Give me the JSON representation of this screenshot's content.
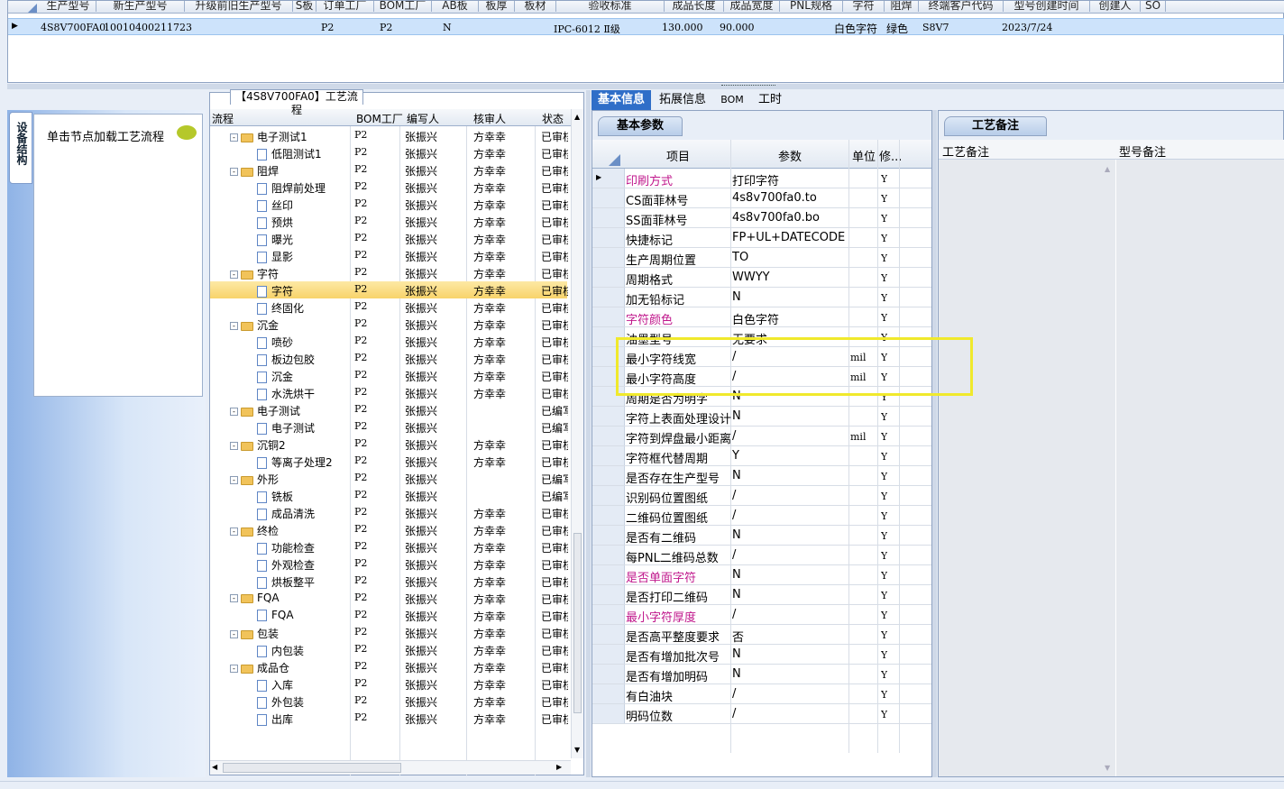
{
  "top_grid": {
    "columns": [
      "生产型号",
      "新生产型号",
      "升级前旧生产型号",
      "S板",
      "订单工厂",
      "BOM工厂",
      "AB板",
      "板厚",
      "板材",
      "验收标准",
      "成品长度",
      "成品宽度",
      "PNL规格",
      "字符",
      "阻焊",
      "终端客户代码",
      "型号创建时间",
      "创建人",
      "SO"
    ],
    "row": {
      "model": "4S8V700FA0",
      "new_model": "10010400211723",
      "order_factory": "P2",
      "bom_factory": "P2",
      "ab": "N",
      "standard": "IPC-6012 Ⅱ级",
      "length": "130.000",
      "width": "90.000",
      "character": "白色字符",
      "solder": "绿色",
      "customer_code": "S8V7",
      "created": "2023/7/24"
    }
  },
  "left_panel": {
    "vertical_tab": "设备结构",
    "load_text": "单击节点加载工艺流程"
  },
  "tree": {
    "title": "【4S8V700FA0】工艺流程",
    "headers": {
      "flow": "流程",
      "bom": "BOM工厂",
      "writer": "编写人",
      "checker": "核审人",
      "status": "状态"
    },
    "rows": [
      {
        "name": "电子测试1",
        "folder": true,
        "bom": "P2",
        "writer": "张振兴",
        "checker": "方幸幸",
        "status": "已审核"
      },
      {
        "name": "低阻测试1",
        "folder": false,
        "bom": "P2",
        "writer": "张振兴",
        "checker": "方幸幸",
        "status": "已审核"
      },
      {
        "name": "阻焊",
        "folder": true,
        "bom": "P2",
        "writer": "张振兴",
        "checker": "方幸幸",
        "status": "已审核"
      },
      {
        "name": "阻焊前处理",
        "folder": false,
        "bom": "P2",
        "writer": "张振兴",
        "checker": "方幸幸",
        "status": "已审核"
      },
      {
        "name": "丝印",
        "folder": false,
        "bom": "P2",
        "writer": "张振兴",
        "checker": "方幸幸",
        "status": "已审核"
      },
      {
        "name": "预烘",
        "folder": false,
        "bom": "P2",
        "writer": "张振兴",
        "checker": "方幸幸",
        "status": "已审核"
      },
      {
        "name": "曝光",
        "folder": false,
        "bom": "P2",
        "writer": "张振兴",
        "checker": "方幸幸",
        "status": "已审核"
      },
      {
        "name": "显影",
        "folder": false,
        "bom": "P2",
        "writer": "张振兴",
        "checker": "方幸幸",
        "status": "已审核"
      },
      {
        "name": "字符",
        "folder": true,
        "bom": "P2",
        "writer": "张振兴",
        "checker": "方幸幸",
        "status": "已审核"
      },
      {
        "name": "字符",
        "folder": false,
        "bom": "P2",
        "writer": "张振兴",
        "checker": "方幸幸",
        "status": "已审核",
        "selected": true
      },
      {
        "name": "终固化",
        "folder": false,
        "bom": "P2",
        "writer": "张振兴",
        "checker": "方幸幸",
        "status": "已审核"
      },
      {
        "name": "沉金",
        "folder": true,
        "bom": "P2",
        "writer": "张振兴",
        "checker": "方幸幸",
        "status": "已审核"
      },
      {
        "name": "喷砂",
        "folder": false,
        "bom": "P2",
        "writer": "张振兴",
        "checker": "方幸幸",
        "status": "已审核"
      },
      {
        "name": "板边包胶",
        "folder": false,
        "bom": "P2",
        "writer": "张振兴",
        "checker": "方幸幸",
        "status": "已审核"
      },
      {
        "name": "沉金",
        "folder": false,
        "bom": "P2",
        "writer": "张振兴",
        "checker": "方幸幸",
        "status": "已审核"
      },
      {
        "name": "水洗烘干",
        "folder": false,
        "bom": "P2",
        "writer": "张振兴",
        "checker": "方幸幸",
        "status": "已审核"
      },
      {
        "name": "电子测试",
        "folder": true,
        "bom": "P2",
        "writer": "张振兴",
        "checker": "",
        "status": "已编写"
      },
      {
        "name": "电子测试",
        "folder": false,
        "bom": "P2",
        "writer": "张振兴",
        "checker": "",
        "status": "已编写"
      },
      {
        "name": "沉铜2",
        "folder": true,
        "bom": "P2",
        "writer": "张振兴",
        "checker": "方幸幸",
        "status": "已审核"
      },
      {
        "name": "等离子处理2",
        "folder": false,
        "bom": "P2",
        "writer": "张振兴",
        "checker": "方幸幸",
        "status": "已审核"
      },
      {
        "name": "外形",
        "folder": true,
        "bom": "P2",
        "writer": "张振兴",
        "checker": "",
        "status": "已编写"
      },
      {
        "name": "铣板",
        "folder": false,
        "bom": "P2",
        "writer": "张振兴",
        "checker": "",
        "status": "已编写"
      },
      {
        "name": "成品清洗",
        "folder": false,
        "bom": "P2",
        "writer": "张振兴",
        "checker": "方幸幸",
        "status": "已审核"
      },
      {
        "name": "终检",
        "folder": true,
        "bom": "P2",
        "writer": "张振兴",
        "checker": "方幸幸",
        "status": "已审核"
      },
      {
        "name": "功能检查",
        "folder": false,
        "bom": "P2",
        "writer": "张振兴",
        "checker": "方幸幸",
        "status": "已审核"
      },
      {
        "name": "外观检查",
        "folder": false,
        "bom": "P2",
        "writer": "张振兴",
        "checker": "方幸幸",
        "status": "已审核"
      },
      {
        "name": "烘板整平",
        "folder": false,
        "bom": "P2",
        "writer": "张振兴",
        "checker": "方幸幸",
        "status": "已审核"
      },
      {
        "name": "FQA",
        "folder": true,
        "bom": "P2",
        "writer": "张振兴",
        "checker": "方幸幸",
        "status": "已审核"
      },
      {
        "name": "FQA",
        "folder": false,
        "bom": "P2",
        "writer": "张振兴",
        "checker": "方幸幸",
        "status": "已审核"
      },
      {
        "name": "包装",
        "folder": true,
        "bom": "P2",
        "writer": "张振兴",
        "checker": "方幸幸",
        "status": "已审核"
      },
      {
        "name": "内包装",
        "folder": false,
        "bom": "P2",
        "writer": "张振兴",
        "checker": "方幸幸",
        "status": "已审核"
      },
      {
        "name": "成品仓",
        "folder": true,
        "bom": "P2",
        "writer": "张振兴",
        "checker": "方幸幸",
        "status": "已审核"
      },
      {
        "name": "入库",
        "folder": false,
        "bom": "P2",
        "writer": "张振兴",
        "checker": "方幸幸",
        "status": "已审核"
      },
      {
        "name": "外包装",
        "folder": false,
        "bom": "P2",
        "writer": "张振兴",
        "checker": "方幸幸",
        "status": "已审核"
      },
      {
        "name": "出库",
        "folder": false,
        "bom": "P2",
        "writer": "张振兴",
        "checker": "方幸幸",
        "status": "已审核"
      }
    ]
  },
  "tabs": [
    "基本信息",
    "拓展信息",
    "BOM",
    "工时"
  ],
  "params": {
    "group_tab": "基本参数",
    "headers": {
      "item": "项目",
      "param": "参数",
      "unit": "单位",
      "mod": "修..."
    },
    "rows": [
      {
        "item": "印刷方式",
        "value": "打印字符",
        "unit": "",
        "mod": "Y",
        "pink": true,
        "current": true
      },
      {
        "item": "CS面菲林号",
        "value": "4s8v700fa0.to",
        "unit": "",
        "mod": "Y"
      },
      {
        "item": "SS面菲林号",
        "value": "4s8v700fa0.bo",
        "unit": "",
        "mod": "Y"
      },
      {
        "item": "快捷标记",
        "value": "FP+UL+DATECODE",
        "unit": "",
        "mod": "Y"
      },
      {
        "item": "生产周期位置",
        "value": "TO",
        "unit": "",
        "mod": "Y"
      },
      {
        "item": "周期格式",
        "value": "WWYY",
        "unit": "",
        "mod": "Y"
      },
      {
        "item": "加无铅标记",
        "value": "N",
        "unit": "",
        "mod": "Y"
      },
      {
        "item": "字符颜色",
        "value": "白色字符",
        "unit": "",
        "mod": "Y",
        "pink": true
      },
      {
        "item": "油墨型号",
        "value": "无要求",
        "unit": "",
        "mod": "Y"
      },
      {
        "item": "最小字符线宽",
        "value": "/",
        "unit": "mil",
        "mod": "Y"
      },
      {
        "item": "最小字符高度",
        "value": "/",
        "unit": "mil",
        "mod": "Y"
      },
      {
        "item": "周期是否为明字",
        "value": "N",
        "unit": "",
        "mod": "Y"
      },
      {
        "item": "字符上表面处理设计",
        "value": "N",
        "unit": "",
        "mod": "Y"
      },
      {
        "item": "字符到焊盘最小距离",
        "value": "/",
        "unit": "mil",
        "mod": "Y"
      },
      {
        "item": "字符框代替周期",
        "value": "Y",
        "unit": "",
        "mod": "Y"
      },
      {
        "item": "是否存在生产型号",
        "value": "N",
        "unit": "",
        "mod": "Y"
      },
      {
        "item": "识别码位置图纸",
        "value": "/",
        "unit": "",
        "mod": "Y"
      },
      {
        "item": "二维码位置图纸",
        "value": "/",
        "unit": "",
        "mod": "Y"
      },
      {
        "item": "是否有二维码",
        "value": "N",
        "unit": "",
        "mod": "Y"
      },
      {
        "item": "每PNL二维码总数",
        "value": "/",
        "unit": "",
        "mod": "Y"
      },
      {
        "item": "是否单面字符",
        "value": "N",
        "unit": "",
        "mod": "Y",
        "pink": true
      },
      {
        "item": "是否打印二维码",
        "value": "N",
        "unit": "",
        "mod": "Y"
      },
      {
        "item": "最小字符厚度",
        "value": "/",
        "unit": "",
        "mod": "Y",
        "pink": true
      },
      {
        "item": "是否高平整度要求",
        "value": "否",
        "unit": "",
        "mod": "Y"
      },
      {
        "item": "是否有增加批次号",
        "value": "N",
        "unit": "",
        "mod": "Y"
      },
      {
        "item": "是否有增加明码",
        "value": "N",
        "unit": "",
        "mod": "Y"
      },
      {
        "item": "有白油块",
        "value": "/",
        "unit": "",
        "mod": "Y"
      },
      {
        "item": "明码位数",
        "value": "/",
        "unit": "",
        "mod": "Y"
      }
    ]
  },
  "notes": {
    "tab": "工艺备注",
    "col1": "工艺备注",
    "col2": "型号备注"
  },
  "colors": {
    "accent": "#2f6ec8",
    "highlight": "#f0e92c",
    "pink": "#c0178c"
  }
}
